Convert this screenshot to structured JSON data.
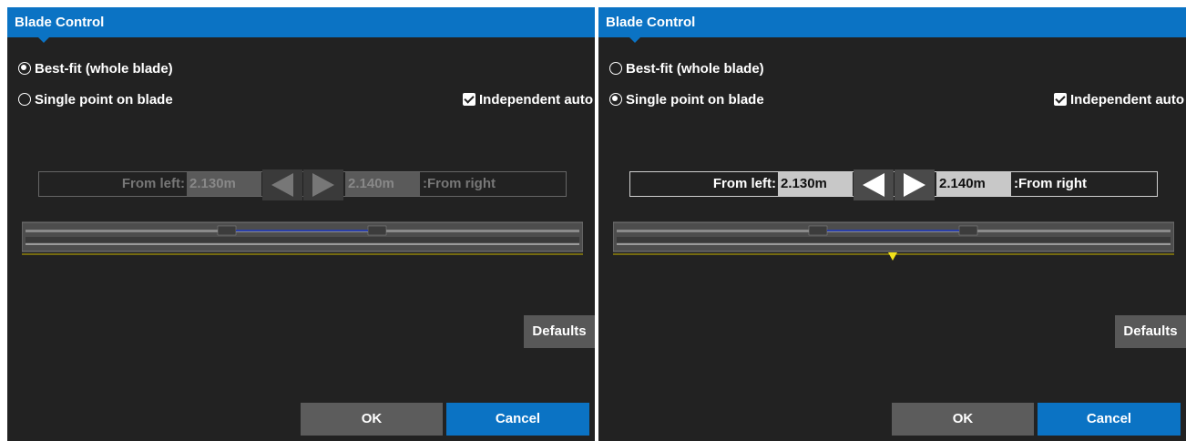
{
  "panels": [
    {
      "title": "Blade Control",
      "options": {
        "best_fit": {
          "label": "Best-fit (whole blade)",
          "selected": true
        },
        "single_point": {
          "label": "Single point on blade",
          "selected": false
        }
      },
      "independent_auto": {
        "label": "Independent auto",
        "checked": true
      },
      "offset": {
        "from_left_label": "From left:",
        "from_left_value": "2.130m",
        "from_right_value": "2.140m",
        "from_right_label": ":From right",
        "enabled": false
      },
      "defaults_label": "Defaults",
      "ok_label": "OK",
      "cancel_label": "Cancel"
    },
    {
      "title": "Blade Control",
      "options": {
        "best_fit": {
          "label": "Best-fit (whole blade)",
          "selected": false
        },
        "single_point": {
          "label": "Single point on blade",
          "selected": true
        }
      },
      "independent_auto": {
        "label": "Independent auto",
        "checked": true
      },
      "offset": {
        "from_left_label": "From left:",
        "from_left_value": "2.130m",
        "from_right_value": "2.140m",
        "from_right_label": ":From right",
        "enabled": true
      },
      "defaults_label": "Defaults",
      "ok_label": "OK",
      "cancel_label": "Cancel"
    }
  ],
  "colors": {
    "title_bar": "#0b73c4",
    "background": "#222222",
    "cancel": "#0b73c4",
    "marker": "#f2e21a"
  }
}
